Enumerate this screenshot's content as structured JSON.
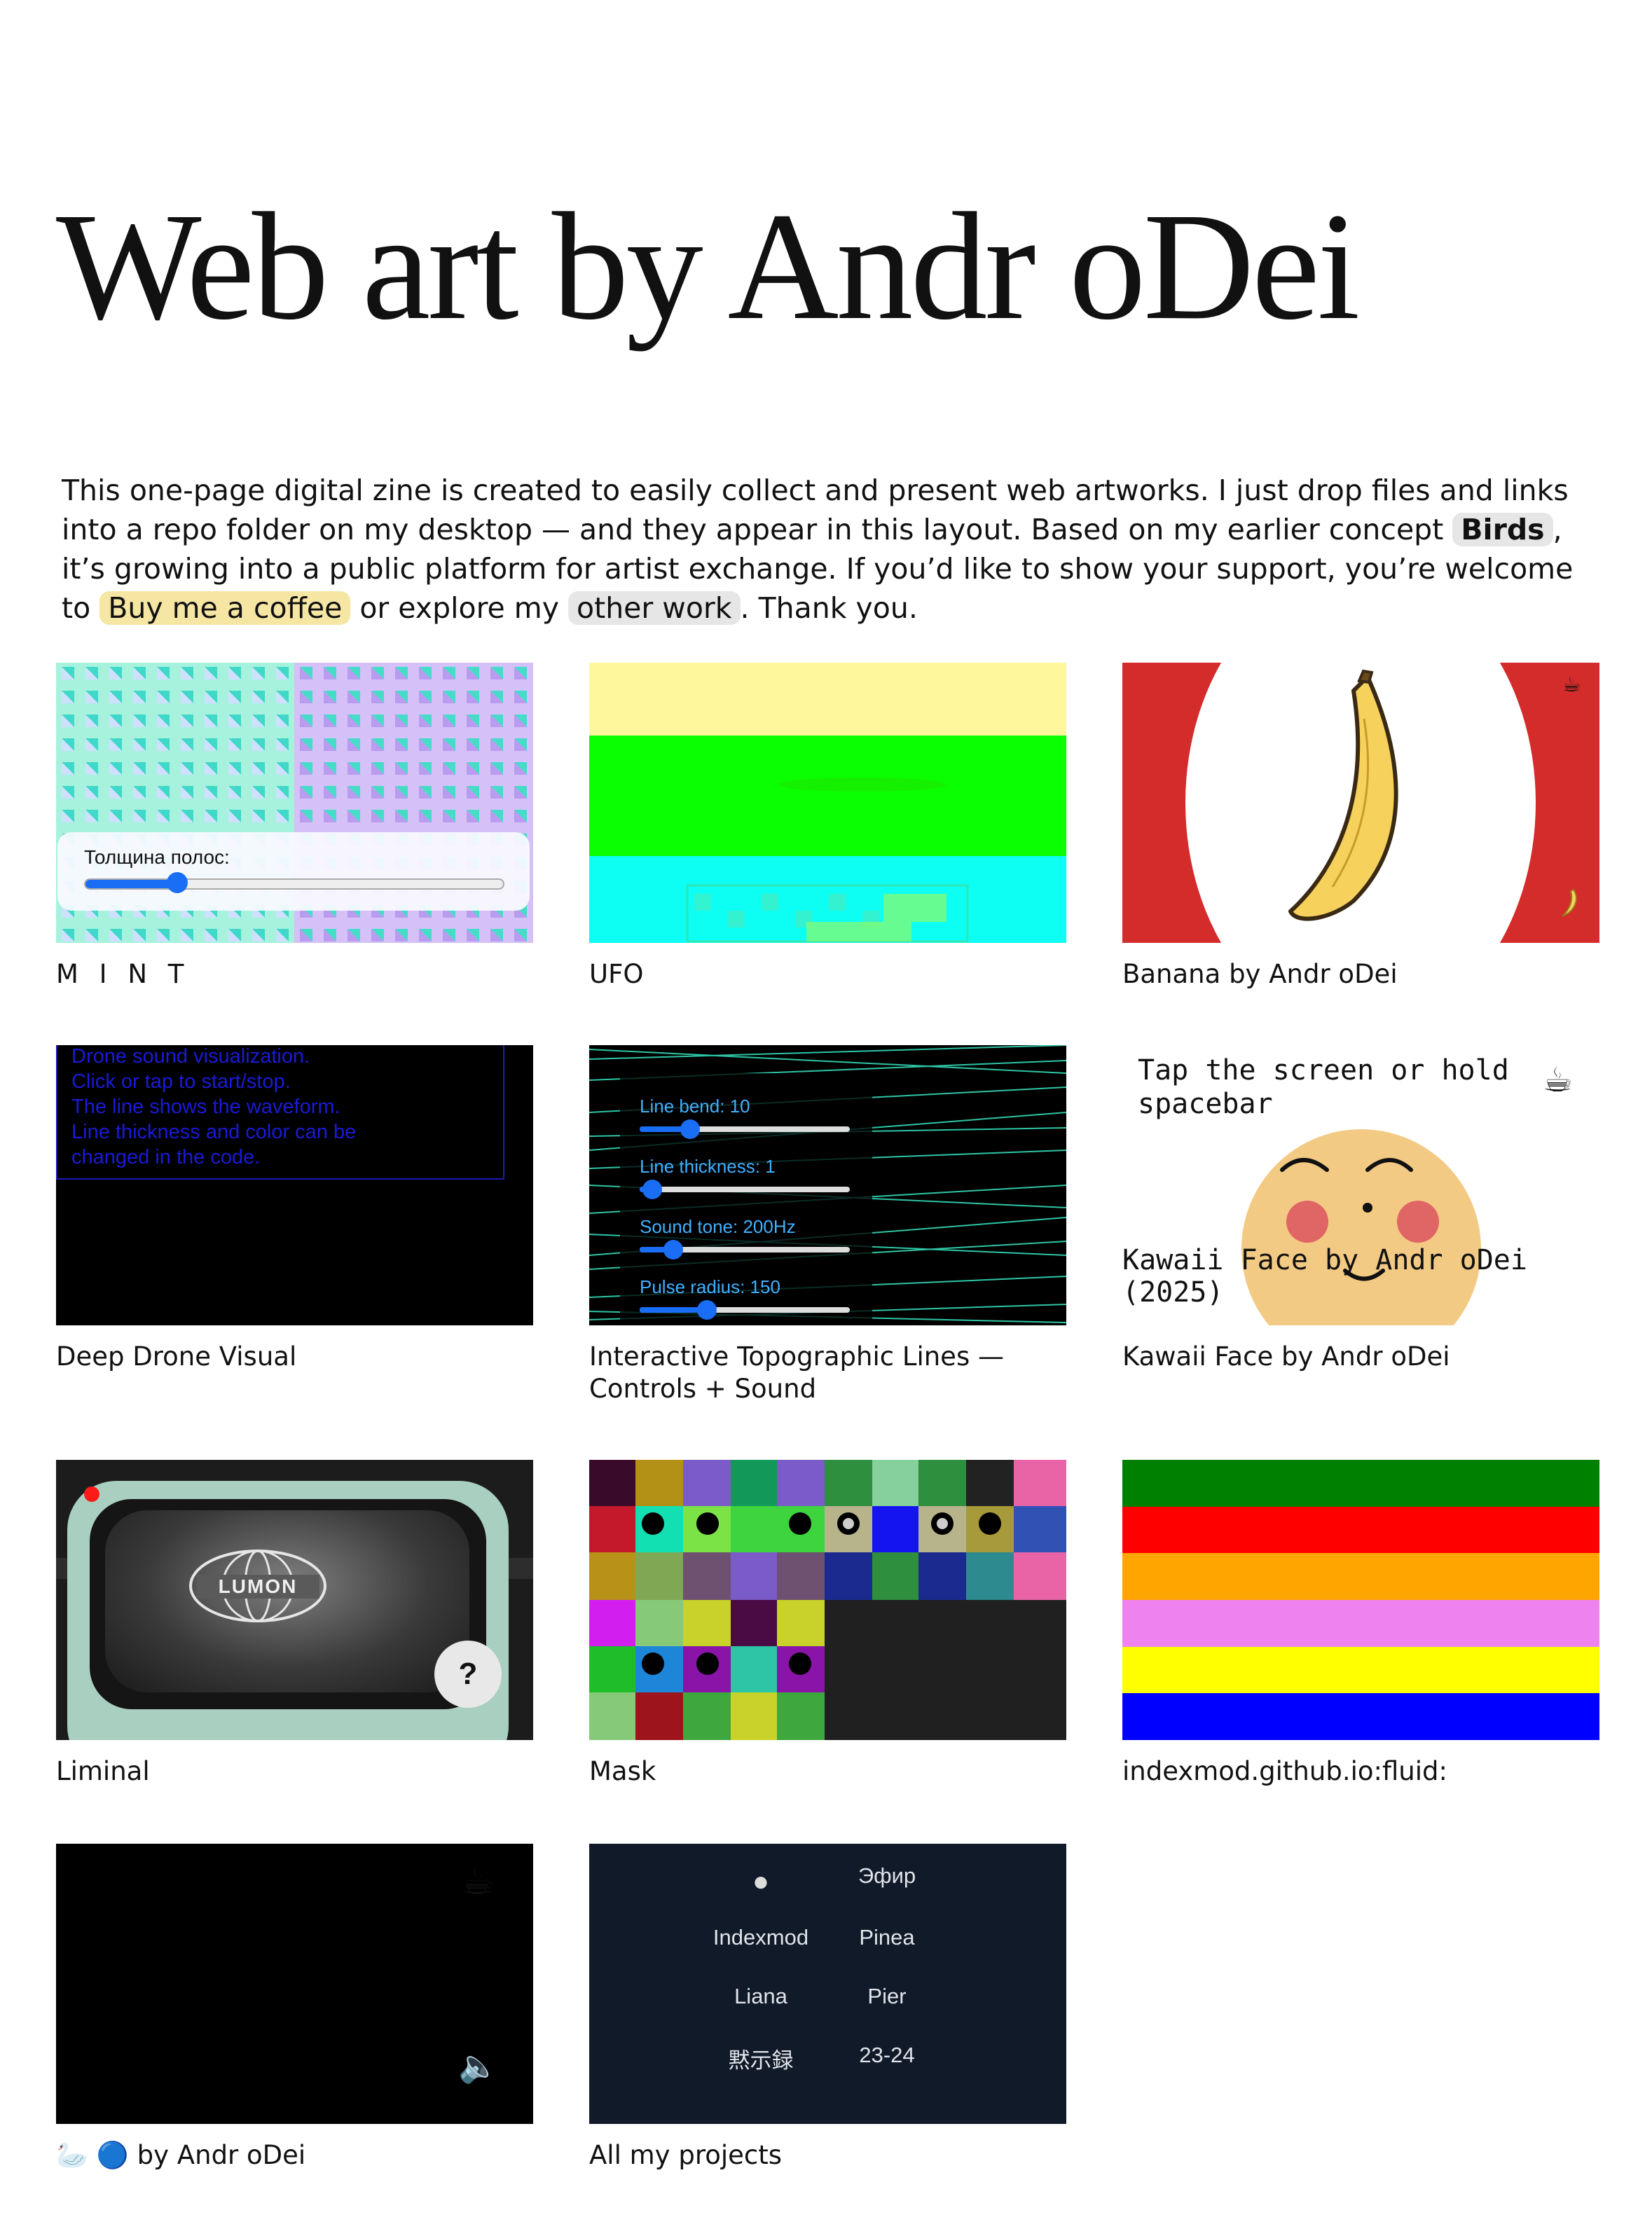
{
  "page": {
    "title": "Web art by Andr oDei",
    "intro": {
      "p1": "This one-page digital zine is created to easily collect and present web artworks. I just drop files and links into a repo folder on my desktop — and they appear in this layout. Based on my earlier concept ",
      "birds_link": "Birds",
      "p2": ", it’s growing into a public platform for artist exchange. If you’d like to show your support, you’re welcome to ",
      "coffee_link": "Buy me a coffee",
      "p3": " or explore my ",
      "other_link": "other work",
      "p4": ". Thank you."
    }
  },
  "cards": [
    {
      "caption": "M I N T",
      "slider_label": "Толщина полос:",
      "slider_value": 0.22
    },
    {
      "caption": "UFO"
    },
    {
      "caption": "Banana by Andr oDei",
      "icons": [
        "coffee-icon",
        "banana-icon"
      ]
    },
    {
      "caption": "Deep Drone Visual",
      "overlay_lines": [
        "Drone sound visualization.",
        "Click or tap to start/stop.",
        "The line shows the waveform.",
        "Line thickness and color can be",
        "changed in the code."
      ]
    },
    {
      "caption": "Interactive Topographic Lines — Controls + Sound",
      "controls": [
        {
          "label": "Line bend: 10",
          "value": 0.24
        },
        {
          "label": "Line thickness: 1",
          "value": 0.06
        },
        {
          "label": "Sound tone: 200Hz",
          "value": 0.16
        },
        {
          "label": "Pulse radius: 150",
          "value": 0.32
        }
      ]
    },
    {
      "caption": "Kawaii Face by Andr oDei",
      "prompt_line1": "Tap the screen or hold",
      "prompt_line2": "spacebar",
      "credit_line1": "Kawaii Face by Andr oDei",
      "credit_line2": "(2025)"
    },
    {
      "caption": "Liminal",
      "screen_text": "LUMON",
      "help_label": "?"
    },
    {
      "caption": "Mask"
    },
    {
      "caption": "indexmod.github.io:fluid:",
      "stripe_colors": [
        "#008000",
        "#ff0000",
        "#ffa500",
        "#ee82ee",
        "#ffff00",
        "#0000ff"
      ]
    },
    {
      "caption": "🦢 🔵 by Andr oDei",
      "icons": [
        "coffee-icon",
        "speaker-icon"
      ]
    },
    {
      "caption": "All my projects",
      "projects": [
        "●",
        "Эфир",
        "Indexmod",
        "Pinea",
        "Liana",
        "Pier",
        "黙示録",
        "23-24"
      ]
    }
  ],
  "colors": {
    "accent": "#1a6ef5",
    "coffee_pill": "#f6e6a4",
    "pill": "#e6e6e6"
  }
}
